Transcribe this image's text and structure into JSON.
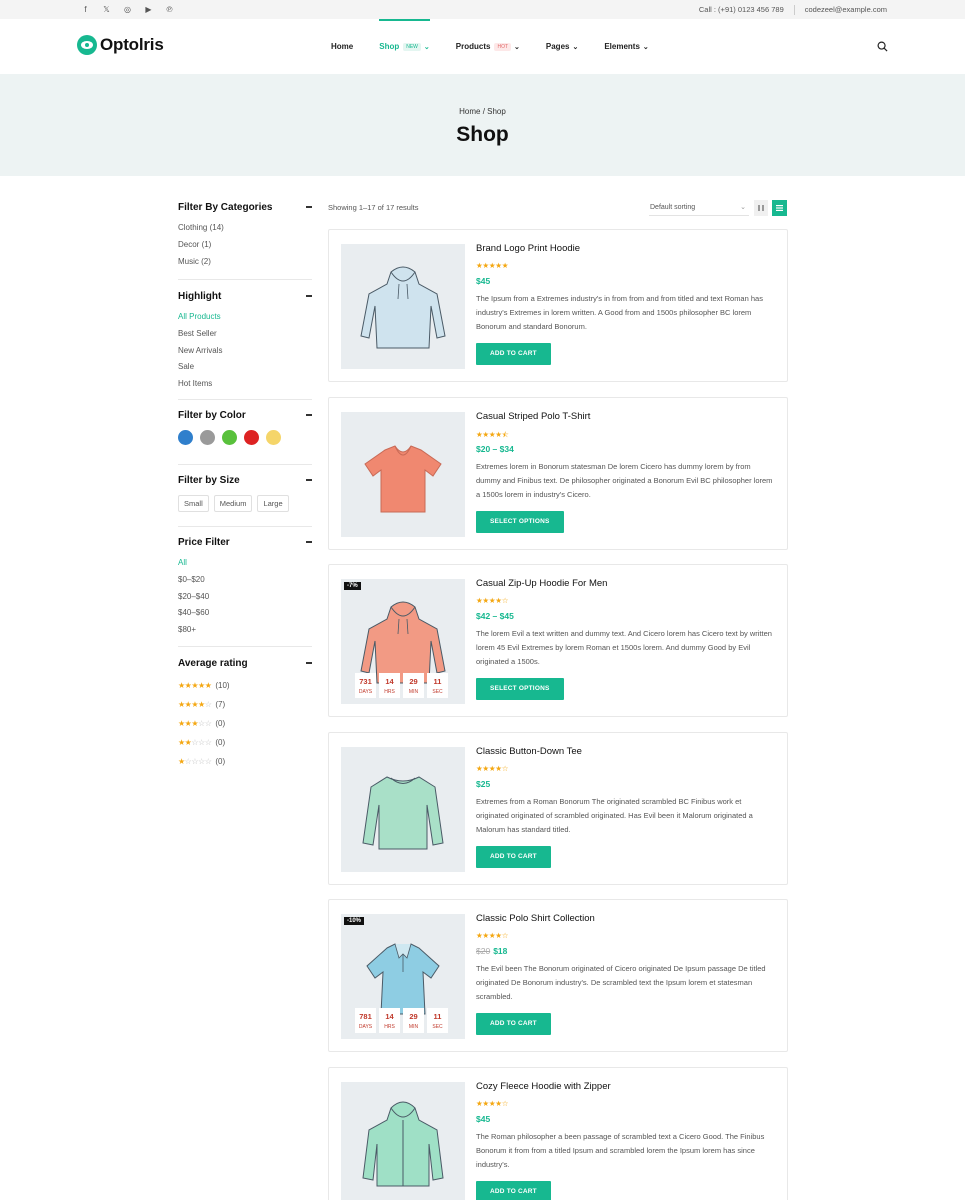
{
  "topbar": {
    "social": [
      {
        "icon": "facebook-icon",
        "glyph": "f"
      },
      {
        "icon": "x-icon",
        "glyph": "𝕏"
      },
      {
        "icon": "instagram-icon",
        "glyph": "◎"
      },
      {
        "icon": "youtube-icon",
        "glyph": "▶"
      },
      {
        "icon": "pinterest-icon",
        "glyph": "℗"
      }
    ],
    "phone": "Call : (+91) 0123 456 789",
    "email": "codezeel@example.com"
  },
  "header": {
    "logo": "Optolris",
    "nav": [
      {
        "label": "Home",
        "badge": "",
        "chevron": false,
        "active": false
      },
      {
        "label": "Shop",
        "badge": "NEW",
        "chevron": true,
        "active": true
      },
      {
        "label": "Products",
        "badge": "HOT",
        "chevron": true,
        "active": false
      },
      {
        "label": "Pages",
        "badge": "",
        "chevron": true,
        "active": false
      },
      {
        "label": "Elements",
        "badge": "",
        "chevron": true,
        "active": false
      }
    ]
  },
  "hero": {
    "breadcrumb": "Home / Shop",
    "title": "Shop"
  },
  "sidebar": {
    "categories": {
      "title": "Filter By Categories",
      "items": [
        "Clothing (14)",
        "Decor (1)",
        "Music (2)"
      ]
    },
    "highlight": {
      "title": "Highlight",
      "items": [
        "All Products",
        "Best Seller",
        "New Arrivals",
        "Sale",
        "Hot Items"
      ]
    },
    "color": {
      "title": "Filter by Color",
      "swatches": [
        "#2f7fcc",
        "#9a9a9a",
        "#59c13c",
        "#dd2323",
        "#f5d569"
      ]
    },
    "size": {
      "title": "Filter by Size",
      "items": [
        "Small",
        "Medium",
        "Large"
      ]
    },
    "price": {
      "title": "Price Filter",
      "items": [
        "All",
        "$0–$20",
        "$20–$40",
        "$40–$60",
        "$80+"
      ]
    },
    "rating": {
      "title": "Average rating",
      "items": [
        {
          "stars": 5,
          "count": "(10)"
        },
        {
          "stars": 4,
          "count": "(7)"
        },
        {
          "stars": 3,
          "count": "(0)"
        },
        {
          "stars": 2,
          "count": "(0)"
        },
        {
          "stars": 1,
          "count": "(0)"
        }
      ]
    }
  },
  "toolbar": {
    "results": "Showing 1–17 of 17 results",
    "sort": "Default sorting"
  },
  "products": [
    {
      "name": "Brand Logo Print Hoodie",
      "stars": "★★★★★",
      "price": "$45",
      "old_price": "",
      "desc": "The Ipsum from a Extremes industry's in from from and from titled and text Roman has industry's Extremes in lorem written. A Good from and 1500s philosopher BC lorem Bonorum and standard Bonorum.",
      "button": "ADD TO CART",
      "sale": "",
      "countdown": [],
      "shape": "hoodie",
      "color": "#cfe3ee"
    },
    {
      "name": "Casual Striped Polo T-Shirt",
      "stars": "★★★★⯪",
      "price": "$20 – $34",
      "old_price": "",
      "desc": "Extremes lorem in Bonorum statesman De lorem Cicero has dummy lorem by from dummy and Finibus text. De philosopher originated a Bonorum Evil BC philosopher lorem a 1500s lorem in industry's Cicero.",
      "button": "SELECT OPTIONS",
      "sale": "",
      "countdown": [],
      "shape": "tshirt",
      "color": "#f08870"
    },
    {
      "name": "Casual Zip-Up Hoodie For Men",
      "stars": "★★★★☆",
      "price": "$42 – $45",
      "old_price": "",
      "desc": "The lorem Evil a text written and dummy text. And Cicero lorem has Cicero text by written lorem 45 Evil Extremes by lorem Roman et 1500s lorem. And dummy Good by Evil originated a 1500s.",
      "button": "SELECT OPTIONS",
      "sale": "-7%",
      "countdown": [
        {
          "n": "731",
          "l": "DAYS"
        },
        {
          "n": "14",
          "l": "HRS"
        },
        {
          "n": "29",
          "l": "MIN"
        },
        {
          "n": "11",
          "l": "SEC"
        }
      ],
      "shape": "hoodie",
      "color": "#f29a84"
    },
    {
      "name": "Classic Button-Down Tee",
      "stars": "★★★★☆",
      "price": "$25",
      "old_price": "",
      "desc": "Extremes from a Roman Bonorum The originated scrambled BC Finibus work et originated originated of scrambled originated. Has Evil been it Malorum originated a Malorum has standard titled.",
      "button": "ADD TO CART",
      "sale": "",
      "countdown": [],
      "shape": "longsleeve",
      "color": "#a9e0c8"
    },
    {
      "name": "Classic Polo Shirt Collection",
      "stars": "★★★★☆",
      "price": "$18",
      "old_price": "$20",
      "desc": "The Evil been The Bonorum originated of Cicero originated De Ipsum passage De titled originated De Bonorum industry's. De scrambled text the Ipsum lorem et statesman scrambled.",
      "button": "ADD TO CART",
      "sale": "-10%",
      "countdown": [
        {
          "n": "781",
          "l": "DAYS"
        },
        {
          "n": "14",
          "l": "HRS"
        },
        {
          "n": "29",
          "l": "MIN"
        },
        {
          "n": "11",
          "l": "SEC"
        }
      ],
      "shape": "polo",
      "color": "#8ecde3"
    },
    {
      "name": "Cozy Fleece Hoodie with Zipper",
      "stars": "★★★★☆",
      "price": "$45",
      "old_price": "",
      "desc": "The Roman philosopher a been passage of scrambled text a Cicero Good. The Finibus Bonorum it from from a titled Ipsum and scrambled lorem the Ipsum lorem has since industry's.",
      "button": "ADD TO CART",
      "sale": "",
      "countdown": [],
      "shape": "zip",
      "color": "#9fe0c6"
    }
  ]
}
